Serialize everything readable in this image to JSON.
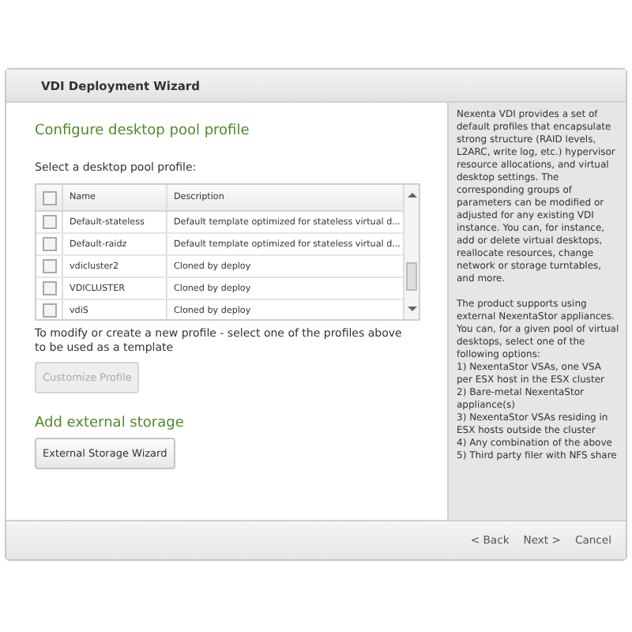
{
  "window": {
    "title": "VDI Deployment Wizard"
  },
  "section_title": "Configure desktop pool profile",
  "table_label": "Select a desktop pool profile:",
  "table": {
    "header_checked": false,
    "columns": [
      "Name",
      "Description"
    ],
    "rows": [
      {
        "checked": false,
        "name": "Default-stateless",
        "description": "Default template optimized for stateless virtual d..."
      },
      {
        "checked": false,
        "name": "Default-raidz",
        "description": "Default template optimized for stateless virtual d..."
      },
      {
        "checked": false,
        "name": "vdicluster2",
        "description": "Cloned by deploy"
      },
      {
        "checked": false,
        "name": "VDICLUSTER",
        "description": "Cloned by deploy"
      },
      {
        "checked": false,
        "name": "vdiS",
        "description": "Cloned by deploy"
      }
    ]
  },
  "hint": "To modify or create a new profile - select one of the profiles above to be used as a template",
  "customize_button": {
    "label": "Customize Profile",
    "disabled": true
  },
  "storage_title": "Add external storage",
  "storage_button": {
    "label": "External Storage Wizard"
  },
  "help": [
    "Nexenta VDI provides a set of default profiles that encapsulate strong structure (RAID levels, L2ARC, write log, etc.) hypervisor resource allocations, and virtual desktop settings. The corresponding groups of parameters can be modified or adjusted for any existing VDI instance. You can, for instance, add or delete virtual desktops, reallocate resources, change network or storage turntables, and more.",
    "The product supports using external NexentaStor appliances. You can, for a given pool of virtual desktops, select one of the following options:\n1) NexentaStor VSAs, one VSA per ESX host in the ESX cluster\n2) Bare-metal NexentaStor appliance(s)\n3) NexentaStor VSAs residing in ESX hosts outside the cluster\n4) Any combination of the above\n5) Third party filer with NFS share"
  ],
  "footer_buttons": [
    "< Back",
    "Next >",
    "Cancel"
  ]
}
